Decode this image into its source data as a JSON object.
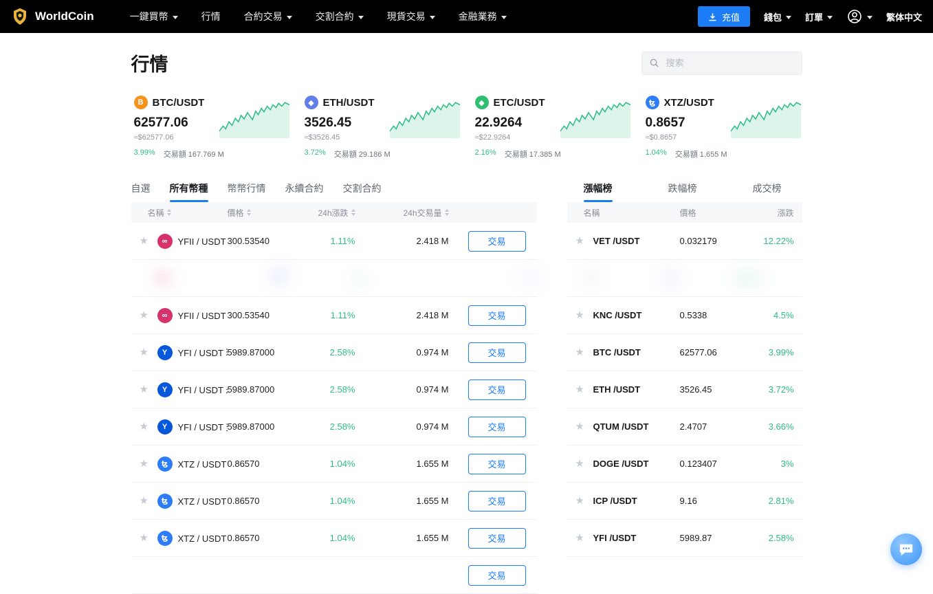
{
  "colors": {
    "accent_blue": "#1b7cf6",
    "up_green": "#2ebd85",
    "navbar_bg": "#000000"
  },
  "navbar": {
    "brand": "WorldCoin",
    "items": [
      {
        "label": "一鍵買幣",
        "dropdown": true
      },
      {
        "label": "行情",
        "dropdown": false
      },
      {
        "label": "合約交易",
        "dropdown": true
      },
      {
        "label": "交割合約",
        "dropdown": true
      },
      {
        "label": "現貨交易",
        "dropdown": true
      },
      {
        "label": "金融業務",
        "dropdown": true
      }
    ],
    "deposit_label": "充值",
    "wallet_label": "錢包",
    "orders_label": "訂單",
    "language_label": "繁体中文"
  },
  "page": {
    "title": "行情",
    "search_placeholder": "搜索"
  },
  "tickers": [
    {
      "pair": "BTC/USDT",
      "price": "62577.06",
      "usd_approx": "≈$62577.06",
      "change": "3.99%",
      "volume_label": "交易額 167.769 M",
      "icon": {
        "glyph": "B",
        "color": "#f7931a"
      }
    },
    {
      "pair": "ETH/USDT",
      "price": "3526.45",
      "usd_approx": "≈$3526.45",
      "change": "3.72%",
      "volume_label": "交易額 29.186 M",
      "icon": {
        "glyph": "◆",
        "color": "#627eea"
      }
    },
    {
      "pair": "ETC/USDT",
      "price": "22.9264",
      "usd_approx": "≈$22.9264",
      "change": "2.16%",
      "volume_label": "交易額 17.385 M",
      "icon": {
        "glyph": "◆",
        "color": "#2fbf71"
      }
    },
    {
      "pair": "XTZ/USDT",
      "price": "0.8657",
      "usd_approx": "≈$0.8657",
      "change": "1.04%",
      "volume_label": "交易額 1.655 M",
      "icon": {
        "glyph": "ꜩ",
        "color": "#2c7df7"
      }
    }
  ],
  "market_panel": {
    "tabs": [
      "自選",
      "所有幣種",
      "幣幣行情",
      "永續合約",
      "交割合約"
    ],
    "active_tab": "所有幣種",
    "headers": [
      "名稱",
      "價格",
      "24h漲跌",
      "24h交易量"
    ],
    "trade_label": "交易",
    "rows": [
      {
        "name": "YFII / USDT 現貨",
        "price": "300.53540",
        "change": "1.11%",
        "volume": "2.418 M",
        "icon": {
          "glyph": "∞",
          "color": "#d6336c"
        }
      },
      {
        "type": "blurred"
      },
      {
        "name": "YFII / USDT 交割",
        "price": "300.53540",
        "change": "1.11%",
        "volume": "2.418 M",
        "icon": {
          "glyph": "∞",
          "color": "#d6336c"
        }
      },
      {
        "name": "YFI / USDT 現貨",
        "price": "5989.87000",
        "change": "2.58%",
        "volume": "0.974 M",
        "icon": {
          "glyph": "Y",
          "color": "#0657da"
        }
      },
      {
        "name": "YFI / USDT 永續",
        "price": "5989.87000",
        "change": "2.58%",
        "volume": "0.974 M",
        "icon": {
          "glyph": "Y",
          "color": "#0657da"
        }
      },
      {
        "name": "YFI / USDT 交割",
        "price": "5989.87000",
        "change": "2.58%",
        "volume": "0.974 M",
        "icon": {
          "glyph": "Y",
          "color": "#0657da"
        }
      },
      {
        "name": "XTZ / USDT 現貨",
        "price": "0.86570",
        "change": "1.04%",
        "volume": "1.655 M",
        "icon": {
          "glyph": "ꜩ",
          "color": "#2c7df7"
        }
      },
      {
        "name": "XTZ / USDT 永續",
        "price": "0.86570",
        "change": "1.04%",
        "volume": "1.655 M",
        "icon": {
          "glyph": "ꜩ",
          "color": "#2c7df7"
        }
      },
      {
        "name": "XTZ / USDT 交割",
        "price": "0.86570",
        "change": "1.04%",
        "volume": "1.655 M",
        "icon": {
          "glyph": "ꜩ",
          "color": "#2c7df7"
        }
      },
      {
        "type": "partial"
      }
    ]
  },
  "ranking_panel": {
    "tabs": [
      "漲幅榜",
      "跌幅榜",
      "成交榜"
    ],
    "active_tab": "漲幅榜",
    "headers": [
      "名稱",
      "價格",
      "漲跌"
    ],
    "rows": [
      {
        "name": "VET /USDT",
        "price": "0.032179",
        "change": "12.22%"
      },
      {
        "type": "blurred"
      },
      {
        "name": "KNC /USDT",
        "price": "0.5338",
        "change": "4.5%"
      },
      {
        "name": "BTC /USDT",
        "price": "62577.06",
        "change": "3.99%"
      },
      {
        "name": "ETH /USDT",
        "price": "3526.45",
        "change": "3.72%"
      },
      {
        "name": "QTUM /USDT",
        "price": "2.4707",
        "change": "3.66%"
      },
      {
        "name": "DOGE /USDT",
        "price": "0.123407",
        "change": "3%"
      },
      {
        "name": "ICP /USDT",
        "price": "9.16",
        "change": "2.81%"
      },
      {
        "name": "YFI /USDT",
        "price": "5989.87",
        "change": "2.58%"
      }
    ]
  }
}
